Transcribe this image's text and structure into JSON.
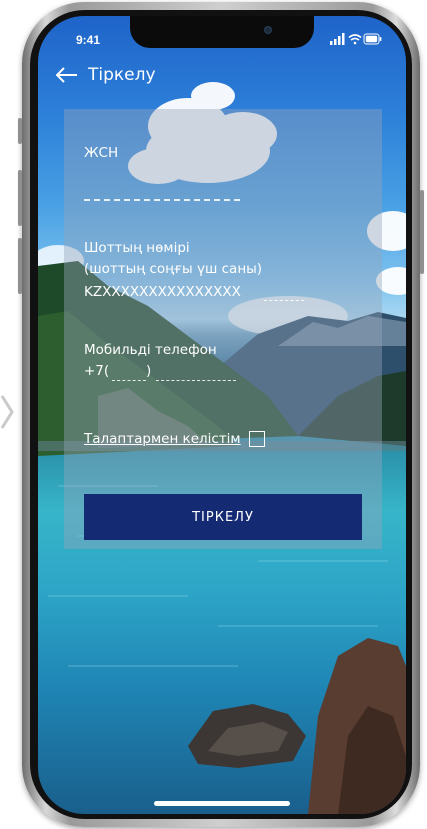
{
  "status_bar": {
    "time": "9:41",
    "icons": [
      "signal-icon",
      "wifi-icon",
      "battery-icon"
    ]
  },
  "header": {
    "back_icon": "arrow-left-icon",
    "title": "Тіркелу"
  },
  "form": {
    "iin": {
      "label": "ЖСН",
      "placeholder": ""
    },
    "account": {
      "label_line1": "Шоттың нөмірі",
      "label_line2": "(шоттың соңғы үш саны)",
      "value": "KZXXXXXXXXXXXXXXX"
    },
    "phone": {
      "label": "Мобильді телефон",
      "prefix": "+7(",
      "suffix": ")"
    },
    "agree": {
      "label": "Талаптармен келістім",
      "checked": false
    },
    "submit_label": "ТІРКЕЛУ"
  },
  "colors": {
    "button": "#142a72",
    "text": "#ffffff"
  }
}
